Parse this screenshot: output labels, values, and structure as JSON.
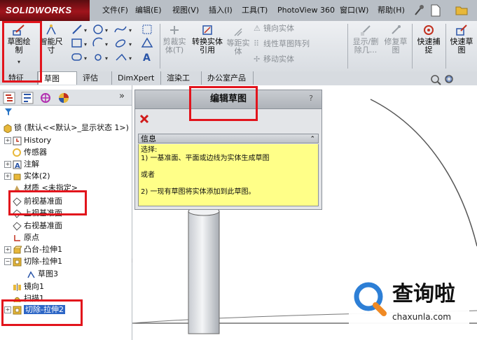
{
  "app": {
    "logo": "SOLIDWORKS"
  },
  "menu": [
    "文件(F)",
    "编辑(E)",
    "视图(V)",
    "插入(I)",
    "工具(T)",
    "PhotoView 360",
    "窗口(W)",
    "帮助(H)"
  ],
  "ribbon": {
    "sketch": "草图绘制",
    "smart_dim": "智能尺寸",
    "trim": "剪裁实体(T)",
    "convert": "转换实体引用",
    "offset": "等距实体",
    "mirror": "镜向实体",
    "linear_pattern": "线性草图阵列",
    "move": "移动实体",
    "show_delete": "显示/删除几...",
    "repair": "修复草图",
    "quick_snap": "快速捕捉",
    "quick_view": "快速草图"
  },
  "tabs": [
    "特征",
    "草图",
    "评估",
    "DimXpert",
    "渲染工具",
    "办公室产品"
  ],
  "tree": {
    "root": "锁 (默认<<默认>_显示状态 1>)",
    "items": [
      "History",
      "传感器",
      "注解",
      "实体(2)",
      "材质 <未指定>",
      "前视基准面",
      "上视基准面",
      "右视基准面",
      "原点",
      "凸台-拉伸1",
      "切除-拉伸1",
      "草图3",
      "镜向1",
      "扫描1",
      "切除-拉伸2"
    ]
  },
  "panel": {
    "title": "编辑草图",
    "help": "?",
    "info_title": "信息",
    "info_lines": [
      "选择:",
      "1) 一基准面、平面或边线为实体生成草图",
      "",
      "或者",
      "",
      "2) 一现有草图将实体添加到此草图。"
    ]
  },
  "watermark": {
    "brand": "查询啦",
    "url": "chaxunla.com"
  },
  "colors": {
    "highlight": "#e2141c",
    "info_bg": "#ffff88",
    "logo": "#a0141c",
    "selected": "#2d66c6"
  }
}
